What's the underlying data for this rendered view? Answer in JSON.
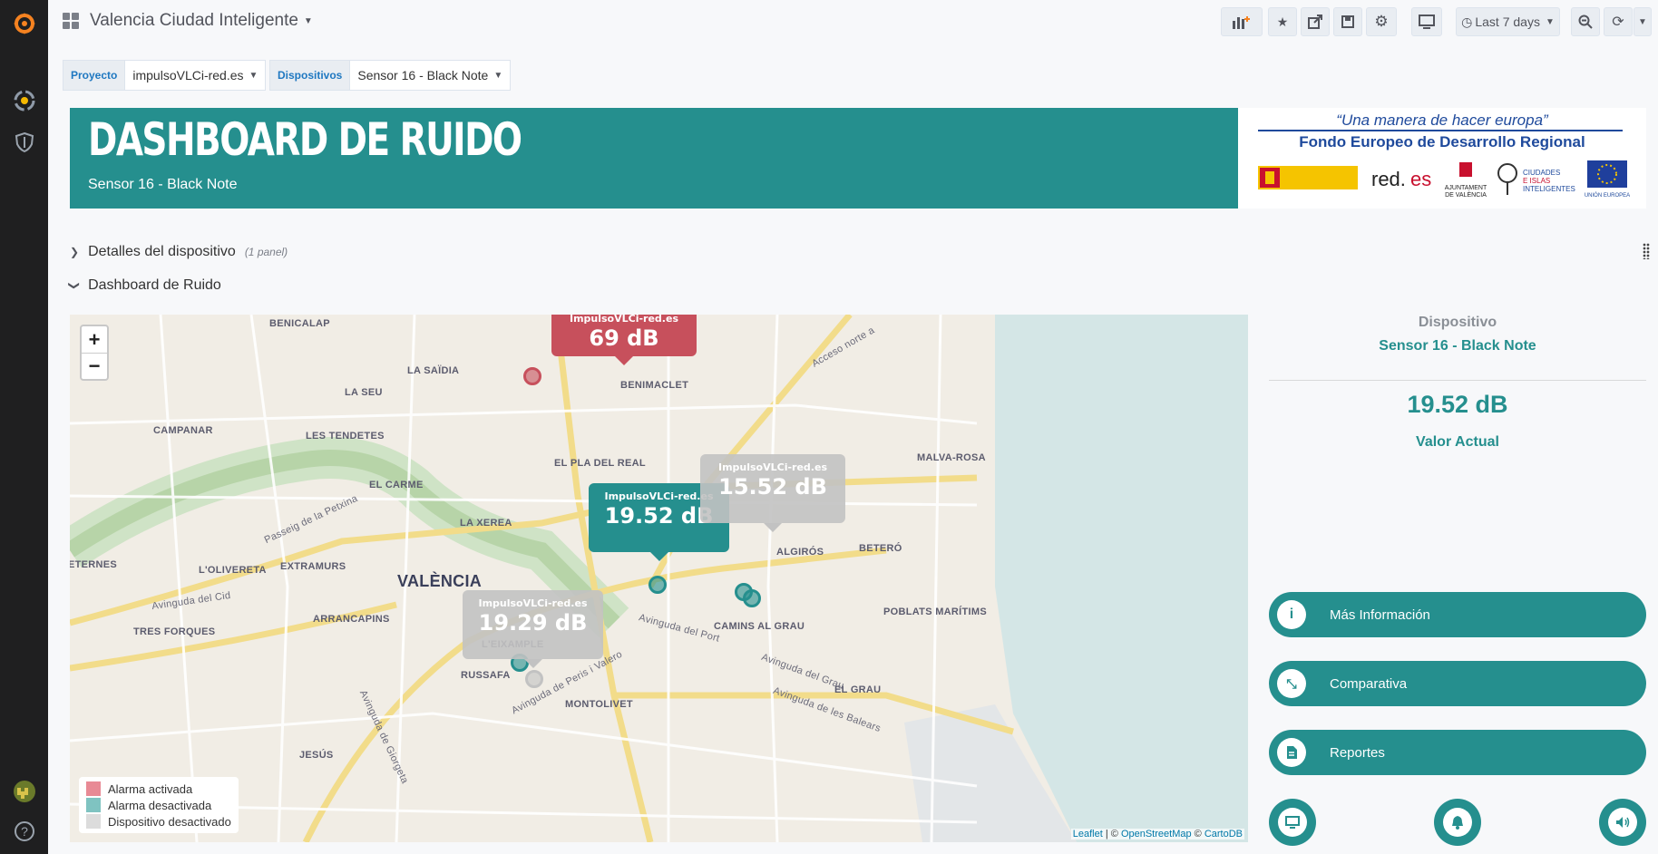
{
  "sidebar": {
    "icons": [
      "grafana-logo-icon",
      "alerting-plugin-icon",
      "shield-icon",
      "user-avatar-icon",
      "help-icon"
    ]
  },
  "header": {
    "title": "Valencia Ciudad Inteligente",
    "time_range": "Last 7 days",
    "buttons": [
      "add-panel-icon",
      "star-icon",
      "share-icon",
      "save-icon",
      "settings-icon",
      "tv-icon",
      "clock-icon",
      "zoom-out-icon",
      "refresh-icon"
    ]
  },
  "variables": {
    "proyecto_label": "Proyecto",
    "proyecto_value": "impulsoVLCi-red.es",
    "dispositivos_label": "Dispositivos",
    "dispositivos_value": "Sensor 16 - Black Note"
  },
  "banner": {
    "title": "DASHBOARD DE RUIDO",
    "subtitle": "Sensor 16 - Black Note"
  },
  "eu_logo": {
    "quote": "“Una manera de hacer europa”",
    "fund": "Fondo Europeo de Desarrollo Regional",
    "logos": [
      "Gobierno de España",
      "red.es",
      "Ajuntament de València",
      "Ciudades e Islas Inteligentes",
      "Unión Europea"
    ]
  },
  "rows": {
    "detalles": {
      "title": "Detalles del dispositivo",
      "count": "(1 panel)"
    },
    "ruido": {
      "title": "Dashboard de Ruido"
    }
  },
  "map": {
    "zoom_in": "+",
    "zoom_out": "−",
    "labels": [
      "BENICALAP",
      "LA SAÏDIA",
      "LA SEU",
      "CAMPANAR",
      "LES TENDETES",
      "EL CARME",
      "EL PLA DEL REAL",
      "MALVA-ROSA",
      "BETERÓ",
      "ALGIRÓS",
      "LA XEREA",
      "EXTRAMURS",
      "L'OLIVERETA",
      "VALÈNCIA",
      "ARRANCAPINS",
      "TRES FORQUES",
      "L'EIXAMPLE",
      "RUSSAFA",
      "MONTOLIVET",
      "CAMINS AL GRAU",
      "POBLATS MARÍTIMS",
      "EL GRAU",
      "JESÚS",
      "BENIMACLET",
      "Avinguda del Cid",
      "Passeig de la Petxina",
      "Avinguda del Port",
      "Avinguda del Grau",
      "Avinguda de les Balears",
      "Avinguda de Peris i Valero",
      "Avinguda de Giorgeta",
      "Acceso norte a",
      "ETERNES"
    ],
    "tooltips": [
      {
        "title": "ImpulsoVLCi-red.es",
        "value": "69 dB",
        "status": "alarm"
      },
      {
        "title": "ImpulsoVLCi-red.es",
        "value": "19.52 dB",
        "status": "ok"
      },
      {
        "title": "ImpulsoVLCi-red.es",
        "value": "15.52 dB",
        "status": "disabled"
      },
      {
        "title": "ImpulsoVLCi-red.es",
        "value": "19.29 dB",
        "status": "disabled"
      }
    ],
    "legend": [
      {
        "label": "Alarma activada",
        "color": "#e88a95"
      },
      {
        "label": "Alarma desactivada",
        "color": "#7fc3c1"
      },
      {
        "label": "Dispositivo desactivado",
        "color": "#dcdcdc"
      }
    ],
    "attribution": {
      "leaflet": "Leaflet",
      "sep": " | © ",
      "osm": "OpenStreetMap",
      "c": " © ",
      "carto": "CartoDB"
    }
  },
  "device_panel": {
    "label": "Dispositivo",
    "name": "Sensor 16 - Black Note",
    "value": "19.52 dB",
    "value_label": "Valor Actual",
    "actions": [
      {
        "label": "Más Información",
        "icon": "info-icon"
      },
      {
        "label": "Comparativa",
        "icon": "compare-icon"
      },
      {
        "label": "Reportes",
        "icon": "document-icon"
      }
    ],
    "round_buttons": [
      "monitor-icon",
      "bell-icon",
      "speaker-icon"
    ]
  },
  "colors": {
    "teal": "#258f8e",
    "alarm": "#c7505c",
    "disabled": "#b8b8b8"
  }
}
